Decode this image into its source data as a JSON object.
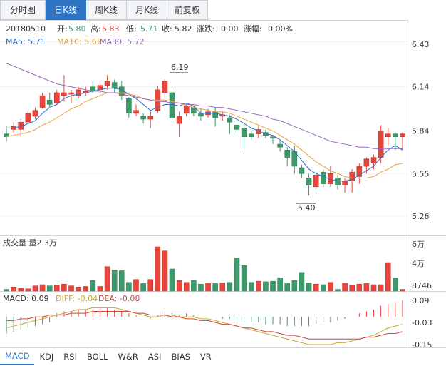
{
  "tabs": [
    {
      "label": "分时图",
      "active": false
    },
    {
      "label": "日K线",
      "active": true
    },
    {
      "label": "周K线",
      "active": false
    },
    {
      "label": "月K线",
      "active": false
    },
    {
      "label": "前复权",
      "active": false
    }
  ],
  "info": {
    "date": "20180510",
    "open_label": "开:",
    "open": "5.80",
    "high_label": "高:",
    "high": "5.83",
    "low_label": "低:",
    "low": "5.71",
    "close_label": "收:",
    "close": "5.82",
    "chg_label": "涨跌:",
    "chg": "0.00",
    "pct_label": "涨幅:",
    "pct": "0.00%"
  },
  "ma": {
    "ma5": "MA5: 5.71",
    "ma10": "MA10: 5.62",
    "ma30": "MA30: 5.72"
  },
  "price_axis": [
    "6.43",
    "6.14",
    "5.84",
    "5.55",
    "5.26"
  ],
  "annotations": {
    "high": "6.19",
    "low": "5.40"
  },
  "volume": {
    "label": "成交量 量2.3万",
    "axis": [
      "6万",
      "4万",
      "8746"
    ]
  },
  "macd": {
    "macd": "MACD: 0.09",
    "diff": "DIFF: -0.04",
    "dea": "DEA: -0.08",
    "axis": [
      "0.09",
      "-0.03",
      "-0.15"
    ]
  },
  "indicators": [
    "MACD",
    "KDJ",
    "RSI",
    "BOLL",
    "W&R",
    "ASI",
    "BIAS",
    "VR"
  ],
  "colors": {
    "up": "#e8453c",
    "down": "#3d9a6a",
    "ma5": "#2f6fc6",
    "ma10": "#e8a33c",
    "ma30": "#9b6bbd",
    "active": "#2d74c4"
  },
  "chart_data": {
    "type": "candlestick",
    "ylim": [
      5.26,
      6.43
    ],
    "candles": [
      {
        "o": 5.82,
        "h": 5.87,
        "l": 5.77,
        "c": 5.8
      },
      {
        "o": 5.85,
        "h": 5.9,
        "l": 5.83,
        "c": 5.87
      },
      {
        "o": 5.85,
        "h": 5.92,
        "l": 5.8,
        "c": 5.9
      },
      {
        "o": 5.9,
        "h": 5.98,
        "l": 5.88,
        "c": 5.96
      },
      {
        "o": 5.94,
        "h": 6.0,
        "l": 5.92,
        "c": 5.98
      },
      {
        "o": 6.0,
        "h": 6.1,
        "l": 5.99,
        "c": 6.08
      },
      {
        "o": 6.05,
        "h": 6.1,
        "l": 6.0,
        "c": 6.02
      },
      {
        "o": 6.03,
        "h": 6.12,
        "l": 6.02,
        "c": 6.1
      },
      {
        "o": 6.08,
        "h": 6.22,
        "l": 6.04,
        "c": 6.1
      },
      {
        "o": 6.09,
        "h": 6.12,
        "l": 6.03,
        "c": 6.1
      },
      {
        "o": 6.08,
        "h": 6.14,
        "l": 6.06,
        "c": 6.12
      },
      {
        "o": 6.1,
        "h": 6.14,
        "l": 6.08,
        "c": 6.11
      },
      {
        "o": 6.14,
        "h": 6.18,
        "l": 6.1,
        "c": 6.11
      },
      {
        "o": 6.12,
        "h": 6.17,
        "l": 6.1,
        "c": 6.15
      },
      {
        "o": 6.15,
        "h": 6.22,
        "l": 6.12,
        "c": 6.18
      },
      {
        "o": 6.17,
        "h": 6.19,
        "l": 6.1,
        "c": 6.13
      },
      {
        "o": 6.14,
        "h": 6.18,
        "l": 6.05,
        "c": 6.08
      },
      {
        "o": 6.06,
        "h": 6.07,
        "l": 5.93,
        "c": 5.96
      },
      {
        "o": 5.96,
        "h": 6.02,
        "l": 5.94,
        "c": 5.98
      },
      {
        "o": 5.94,
        "h": 5.96,
        "l": 5.89,
        "c": 5.92
      },
      {
        "o": 5.92,
        "h": 5.98,
        "l": 5.86,
        "c": 5.94
      },
      {
        "o": 5.98,
        "h": 6.15,
        "l": 5.96,
        "c": 6.12
      },
      {
        "o": 6.1,
        "h": 6.19,
        "l": 6.06,
        "c": 6.18
      },
      {
        "o": 6.1,
        "h": 6.12,
        "l": 5.9,
        "c": 5.93
      },
      {
        "o": 5.89,
        "h": 5.97,
        "l": 5.8,
        "c": 5.94
      },
      {
        "o": 5.96,
        "h": 6.03,
        "l": 5.94,
        "c": 6.01
      },
      {
        "o": 6.0,
        "h": 6.01,
        "l": 5.94,
        "c": 5.96
      },
      {
        "o": 5.96,
        "h": 5.99,
        "l": 5.91,
        "c": 5.94
      },
      {
        "o": 5.95,
        "h": 5.99,
        "l": 5.93,
        "c": 5.97
      },
      {
        "o": 5.97,
        "h": 6.0,
        "l": 5.87,
        "c": 5.93
      },
      {
        "o": 5.94,
        "h": 5.97,
        "l": 5.91,
        "c": 5.95
      },
      {
        "o": 5.93,
        "h": 5.95,
        "l": 5.82,
        "c": 5.9
      },
      {
        "o": 5.88,
        "h": 5.9,
        "l": 5.83,
        "c": 5.85
      },
      {
        "o": 5.86,
        "h": 5.88,
        "l": 5.71,
        "c": 5.8
      },
      {
        "o": 5.82,
        "h": 5.84,
        "l": 5.78,
        "c": 5.8
      },
      {
        "o": 5.82,
        "h": 5.87,
        "l": 5.79,
        "c": 5.85
      },
      {
        "o": 5.83,
        "h": 5.85,
        "l": 5.79,
        "c": 5.81
      },
      {
        "o": 5.8,
        "h": 5.81,
        "l": 5.75,
        "c": 5.79
      },
      {
        "o": 5.75,
        "h": 5.78,
        "l": 5.7,
        "c": 5.73
      },
      {
        "o": 5.71,
        "h": 5.73,
        "l": 5.6,
        "c": 5.66
      },
      {
        "o": 5.7,
        "h": 5.74,
        "l": 5.55,
        "c": 5.6
      },
      {
        "o": 5.59,
        "h": 5.61,
        "l": 5.52,
        "c": 5.55
      },
      {
        "o": 5.52,
        "h": 5.55,
        "l": 5.4,
        "c": 5.47
      },
      {
        "o": 5.46,
        "h": 5.56,
        "l": 5.44,
        "c": 5.54
      },
      {
        "o": 5.56,
        "h": 5.58,
        "l": 5.46,
        "c": 5.48
      },
      {
        "o": 5.48,
        "h": 5.6,
        "l": 5.46,
        "c": 5.55
      },
      {
        "o": 5.52,
        "h": 5.54,
        "l": 5.44,
        "c": 5.47
      },
      {
        "o": 5.47,
        "h": 5.52,
        "l": 5.42,
        "c": 5.5
      },
      {
        "o": 5.5,
        "h": 5.58,
        "l": 5.42,
        "c": 5.56
      },
      {
        "o": 5.53,
        "h": 5.62,
        "l": 5.48,
        "c": 5.6
      },
      {
        "o": 5.6,
        "h": 5.66,
        "l": 5.55,
        "c": 5.65
      },
      {
        "o": 5.62,
        "h": 5.68,
        "l": 5.58,
        "c": 5.66
      },
      {
        "o": 5.66,
        "h": 5.88,
        "l": 5.62,
        "c": 5.84
      },
      {
        "o": 5.8,
        "h": 5.86,
        "l": 5.74,
        "c": 5.82
      },
      {
        "o": 5.82,
        "h": 5.83,
        "l": 5.71,
        "c": 5.8
      },
      {
        "o": 5.8,
        "h": 5.83,
        "l": 5.71,
        "c": 5.82
      }
    ],
    "volumes": [
      300,
      700,
      500,
      400,
      900,
      1100,
      900,
      1000,
      1200,
      900,
      700,
      800,
      1800,
      800,
      4200,
      3600,
      3500,
      1500,
      2000,
      1300,
      2000,
      7600,
      6900,
      3800,
      1800,
      1500,
      1800,
      1200,
      1400,
      1300,
      1400,
      1500,
      5700,
      4400,
      1500,
      1700,
      1600,
      1700,
      2300,
      1400,
      1800,
      3200,
      1400,
      1200,
      1100,
      1500,
      300,
      1400,
      1000,
      1200,
      1300,
      1100,
      1100,
      4900,
      2300,
      300
    ],
    "ma5": [
      5.86,
      5.86,
      5.87,
      5.89,
      5.91,
      5.96,
      6.0,
      6.02,
      6.06,
      6.08,
      6.09,
      6.1,
      6.11,
      6.12,
      6.13,
      6.13,
      6.12,
      6.09,
      6.06,
      6.02,
      5.98,
      6.0,
      6.02,
      6.02,
      6.01,
      6.03,
      6.01,
      5.96,
      5.96,
      5.96,
      5.95,
      5.94,
      5.92,
      5.89,
      5.86,
      5.84,
      5.82,
      5.81,
      5.78,
      5.74,
      5.7,
      5.64,
      5.58,
      5.55,
      5.53,
      5.51,
      5.5,
      5.5,
      5.51,
      5.54,
      5.57,
      5.6,
      5.66,
      5.71,
      5.74,
      5.71
    ],
    "ma10": [
      5.8,
      5.81,
      5.82,
      5.83,
      5.85,
      5.88,
      5.9,
      5.93,
      5.96,
      5.99,
      6.01,
      6.04,
      6.06,
      6.08,
      6.1,
      6.1,
      6.1,
      6.09,
      6.08,
      6.06,
      6.05,
      6.05,
      6.05,
      6.04,
      6.03,
      6.01,
      6.0,
      5.99,
      5.98,
      5.97,
      5.97,
      5.96,
      5.94,
      5.92,
      5.9,
      5.88,
      5.86,
      5.84,
      5.81,
      5.78,
      5.75,
      5.71,
      5.67,
      5.63,
      5.6,
      5.57,
      5.55,
      5.53,
      5.52,
      5.52,
      5.52,
      5.53,
      5.56,
      5.58,
      5.61,
      5.62
    ],
    "ma30": [
      6.3,
      6.28,
      6.26,
      6.24,
      6.22,
      6.2,
      6.18,
      6.16,
      6.15,
      6.14,
      6.13,
      6.12,
      6.11,
      6.11,
      6.1,
      6.1,
      6.09,
      6.08,
      6.07,
      6.06,
      6.05,
      6.04,
      6.04,
      6.03,
      6.03,
      6.02,
      6.02,
      6.01,
      6.01,
      6.0,
      6.0,
      5.99,
      5.98,
      5.97,
      5.96,
      5.95,
      5.94,
      5.92,
      5.91,
      5.89,
      5.87,
      5.85,
      5.83,
      5.81,
      5.79,
      5.77,
      5.76,
      5.75,
      5.74,
      5.73,
      5.73,
      5.72,
      5.72,
      5.72,
      5.72,
      5.72
    ],
    "macd": [
      -0.09,
      -0.08,
      -0.07,
      -0.06,
      -0.05,
      -0.04,
      -0.03,
      0.02,
      0.03,
      0.03,
      0.04,
      0.04,
      0.04,
      0.05,
      0.05,
      0.04,
      0.03,
      0.02,
      0.01,
      0.0,
      -0.01,
      0.01,
      0.03,
      0.02,
      0.01,
      0.02,
      0.01,
      0.0,
      0.0,
      0.0,
      -0.01,
      -0.01,
      -0.02,
      -0.03,
      -0.03,
      -0.03,
      -0.04,
      -0.04,
      -0.04,
      -0.05,
      -0.05,
      -0.05,
      -0.05,
      -0.04,
      -0.03,
      -0.03,
      -0.02,
      -0.01,
      0.0,
      0.02,
      0.03,
      0.04,
      0.06,
      0.07,
      0.08,
      0.09
    ],
    "diff": [
      -0.06,
      -0.05,
      -0.04,
      -0.03,
      -0.02,
      -0.01,
      0.0,
      0.01,
      0.02,
      0.03,
      0.04,
      0.04,
      0.05,
      0.05,
      0.05,
      0.05,
      0.04,
      0.03,
      0.02,
      0.01,
      0.0,
      0.0,
      0.01,
      0.01,
      0.0,
      0.0,
      0.0,
      -0.01,
      -0.01,
      -0.02,
      -0.03,
      -0.04,
      -0.05,
      -0.06,
      -0.07,
      -0.08,
      -0.09,
      -0.1,
      -0.11,
      -0.12,
      -0.13,
      -0.14,
      -0.15,
      -0.15,
      -0.15,
      -0.15,
      -0.14,
      -0.14,
      -0.13,
      -0.12,
      -0.11,
      -0.1,
      -0.08,
      -0.06,
      -0.05,
      -0.04
    ],
    "dea": [
      -0.02,
      -0.02,
      -0.01,
      -0.01,
      0.0,
      0.0,
      0.01,
      0.01,
      0.01,
      0.02,
      0.02,
      0.02,
      0.03,
      0.03,
      0.03,
      0.03,
      0.03,
      0.03,
      0.02,
      0.02,
      0.01,
      0.01,
      0.01,
      0.0,
      0.0,
      -0.01,
      -0.01,
      -0.02,
      -0.02,
      -0.03,
      -0.04,
      -0.04,
      -0.05,
      -0.06,
      -0.06,
      -0.07,
      -0.08,
      -0.08,
      -0.09,
      -0.1,
      -0.1,
      -0.11,
      -0.12,
      -0.12,
      -0.12,
      -0.12,
      -0.12,
      -0.12,
      -0.12,
      -0.12,
      -0.11,
      -0.11,
      -0.1,
      -0.09,
      -0.09,
      -0.08
    ]
  }
}
